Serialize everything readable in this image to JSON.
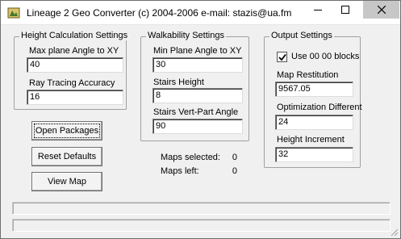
{
  "window": {
    "title": "Lineage 2 Geo Converter (c) 2004-2006 e-mail: stazis@ua.fm",
    "icon": "app-icon"
  },
  "height_calc": {
    "title": "Height Calculation Settings",
    "max_plane_label": "Max plane Angle to XY",
    "max_plane_value": "40",
    "ray_tracing_label": "Ray Tracing Accuracy",
    "ray_tracing_value": "16"
  },
  "walkability": {
    "title": "Walkability Settings",
    "min_plane_label": "Min Plane Angle to XY",
    "min_plane_value": "30",
    "stairs_height_label": "Stairs Height",
    "stairs_height_value": "8",
    "stairs_vert_label": "Stairs Vert-Part Angle",
    "stairs_vert_value": "90"
  },
  "output": {
    "title": "Output Settings",
    "use_blocks_label": "Use 00 00 blocks",
    "use_blocks_checked": true,
    "map_restitution_label": "Map Restitution",
    "map_restitution_value": "9567.05",
    "optimization_label": "Optimization Different",
    "optimization_value": "24",
    "height_increment_label": "Height Increment",
    "height_increment_value": "32"
  },
  "buttons": {
    "open_packages": "Open Packages",
    "reset_defaults": "Reset Defaults",
    "view_map": "View Map"
  },
  "stats": {
    "maps_selected_label": "Maps selected:",
    "maps_selected_value": "0",
    "maps_left_label": "Maps left:",
    "maps_left_value": "0"
  },
  "colors": {
    "window_bg": "#f0f0f0",
    "close_button_bg": "#c7c7c7"
  }
}
